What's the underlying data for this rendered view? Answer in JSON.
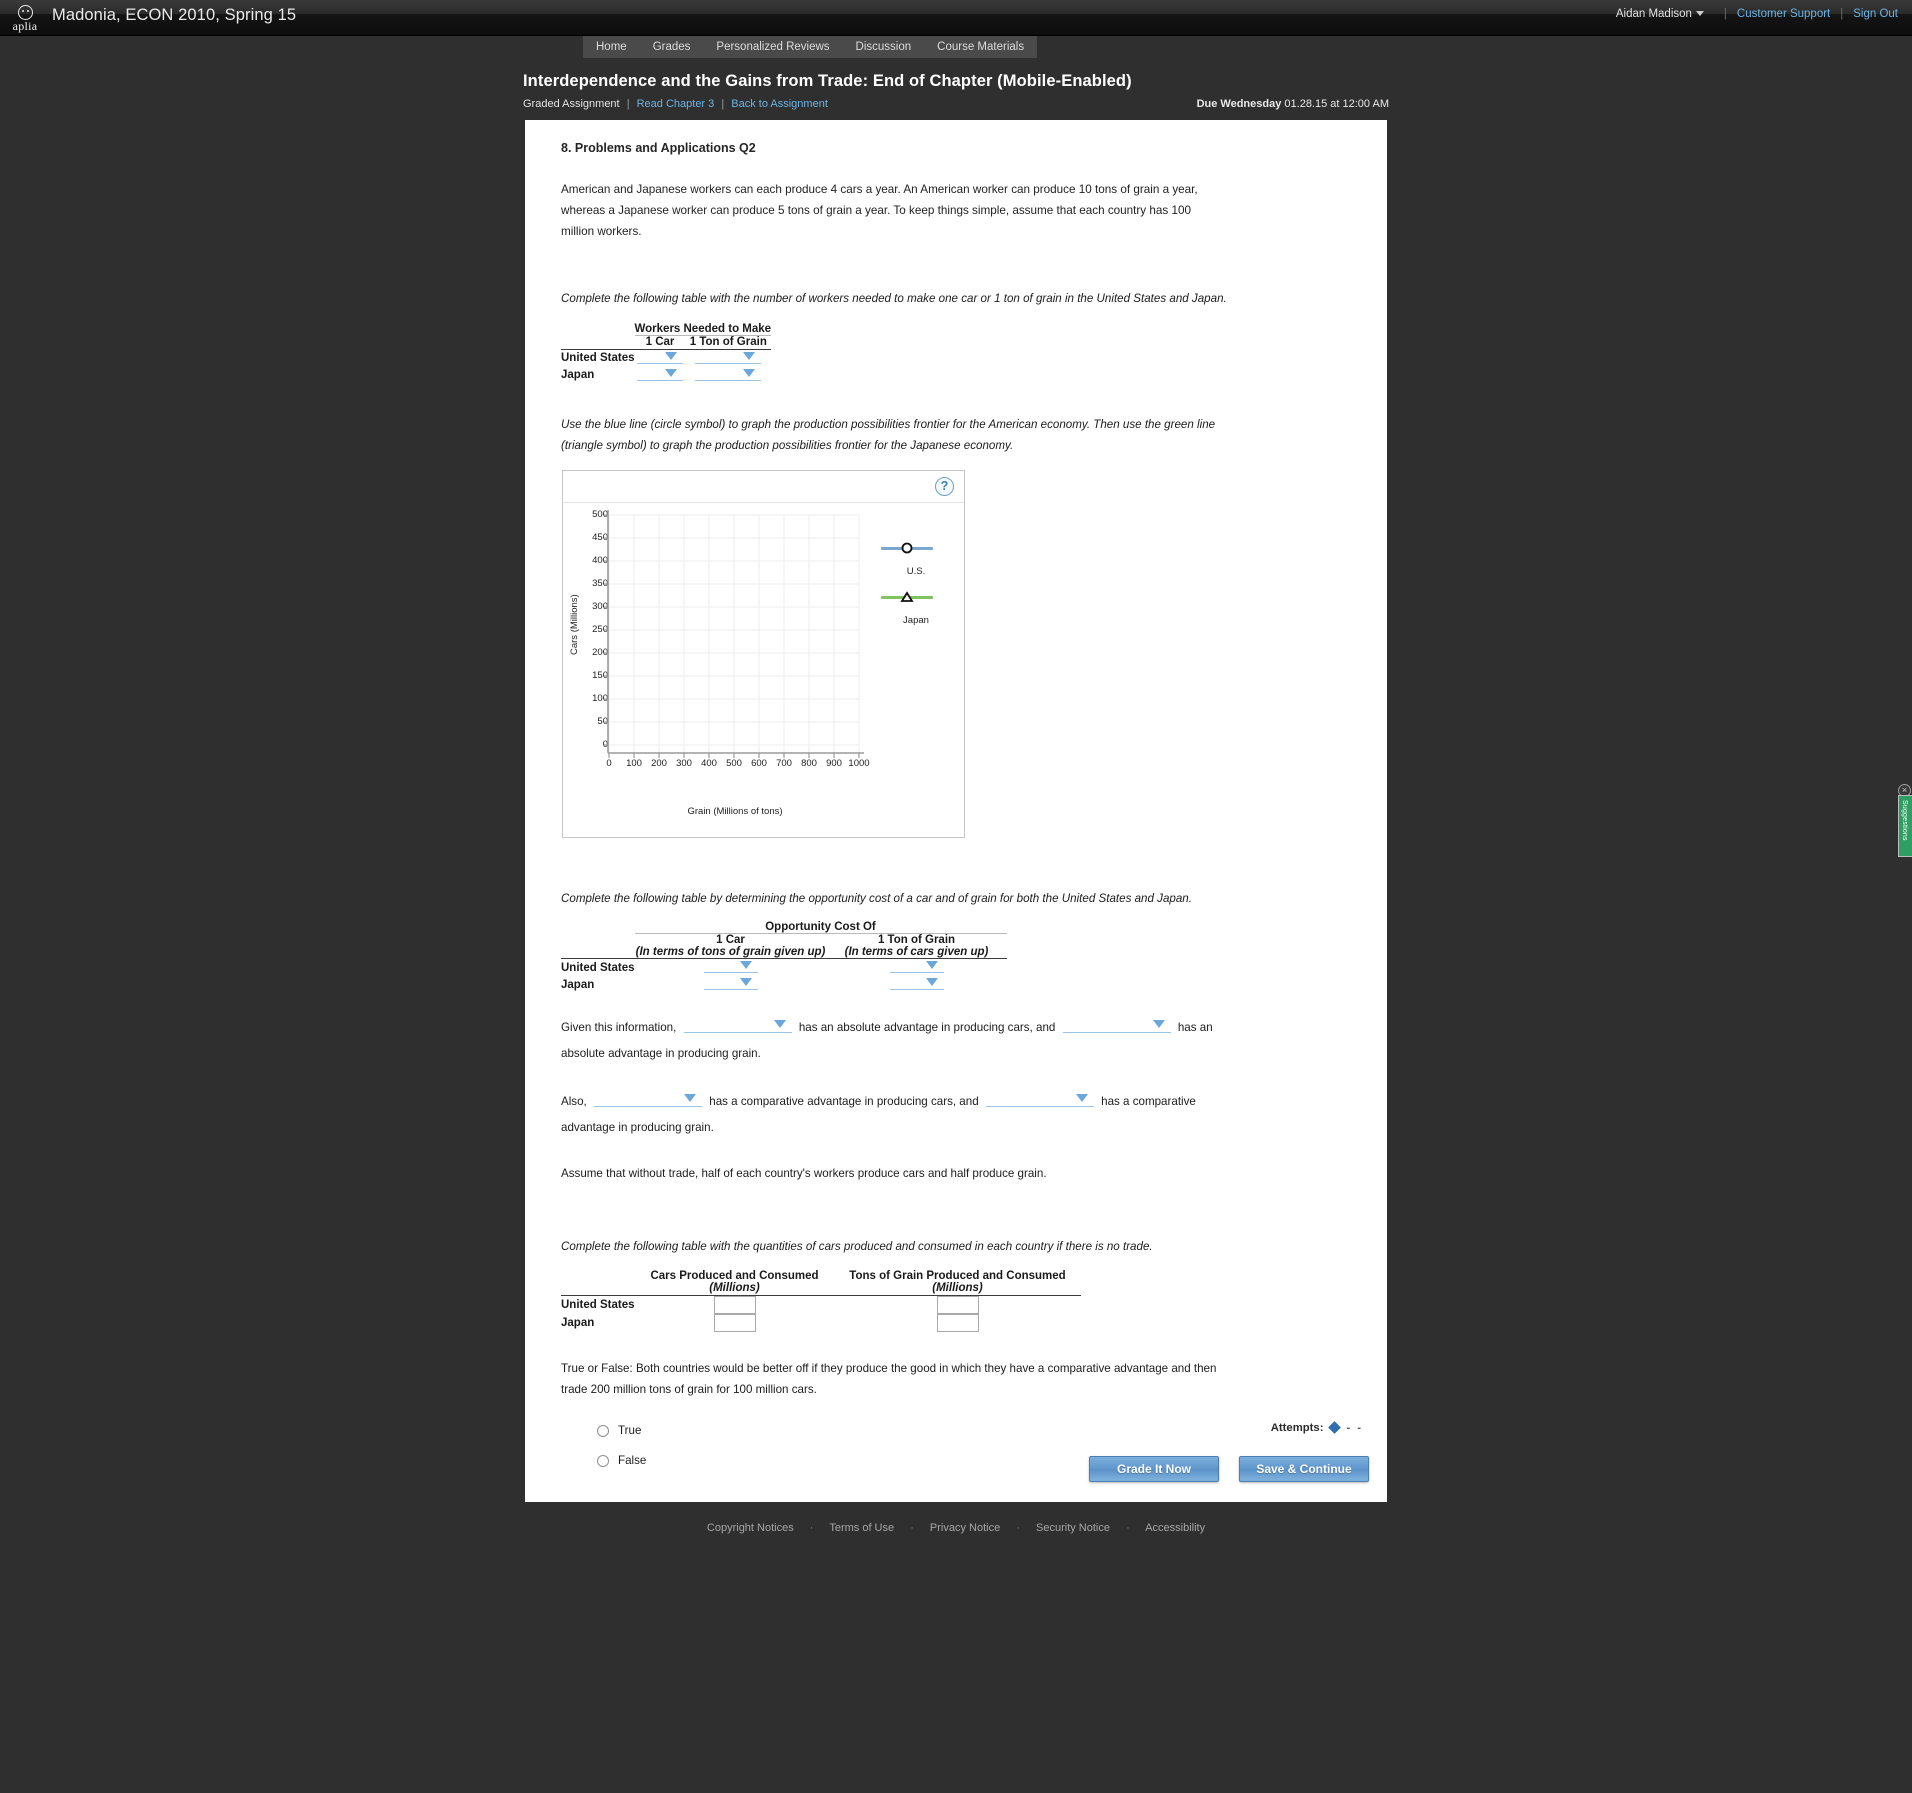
{
  "topbar": {
    "logo_text": "aplia",
    "course_title": "Madonia, ECON 2010, Spring 15",
    "user_name": "Aidan Madison",
    "customer_support": "Customer Support",
    "sign_out": "Sign Out"
  },
  "nav": {
    "items": [
      {
        "label": "Home"
      },
      {
        "label": "Grades"
      },
      {
        "label": "Personalized Reviews"
      },
      {
        "label": "Discussion"
      },
      {
        "label": "Course Materials"
      }
    ]
  },
  "assignment": {
    "title": "Interdependence and the Gains from Trade: End of Chapter (Mobile-Enabled)",
    "type_label": "Graded Assignment",
    "read_chapter_link": "Read Chapter 3",
    "back_link": "Back to Assignment",
    "due_prefix": "Due Wednesday",
    "due_value": "01.28.15 at 12:00 AM"
  },
  "question": {
    "heading": "8. Problems and Applications Q2",
    "body": "American and Japanese workers can each produce 4 cars a year. An American worker can produce 10 tons of grain a year, whereas a Japanese worker can produce 5 tons of grain a year. To keep things simple, assume that each country has 100 million workers."
  },
  "workers_table": {
    "prompt": "Complete the following table with the number of workers needed to make one car or 1 ton of grain in the United States and Japan.",
    "group_header": "Workers Needed to Make",
    "columns": [
      "1 Car",
      "1 Ton of Grain"
    ],
    "rows": [
      {
        "label": "United States",
        "car": "",
        "grain": ""
      },
      {
        "label": "Japan",
        "car": "",
        "grain": ""
      }
    ]
  },
  "graph": {
    "prompt": "Use the blue line (circle symbol) to graph the production possibilities frontier for the American economy. Then use the green line (triangle symbol) to graph the production possibilities frontier for the Japanese economy.",
    "help_label": "?",
    "legend": [
      {
        "label": "U.S.",
        "color": "#7ba7d0",
        "symbol": "circle"
      },
      {
        "label": "Japan",
        "color": "#7fc45c",
        "symbol": "triangle"
      }
    ]
  },
  "chart_data": {
    "type": "line",
    "title": "",
    "xlabel": "Grain (Millions of tons)",
    "ylabel": "Cars (Millions)",
    "xlim": [
      0,
      1000
    ],
    "ylim": [
      0,
      500
    ],
    "xticks": [
      0,
      100,
      200,
      300,
      400,
      500,
      600,
      700,
      800,
      900,
      1000
    ],
    "yticks": [
      0,
      50,
      100,
      150,
      200,
      250,
      300,
      350,
      400,
      450,
      500
    ],
    "grid": true,
    "legend_position": "right",
    "series": [
      {
        "name": "U.S.",
        "color": "#7ba7d0",
        "symbol": "circle",
        "x": [],
        "y": []
      },
      {
        "name": "Japan",
        "color": "#7fc45c",
        "symbol": "triangle",
        "x": [],
        "y": []
      }
    ]
  },
  "opp_cost_table": {
    "prompt": "Complete the following table by determining the opportunity cost of a car and of grain for both the United States and Japan.",
    "group_header": "Opportunity Cost Of",
    "columns": [
      {
        "title": "1 Car",
        "sub": "(In terms of tons of grain given up)"
      },
      {
        "title": "1 Ton of Grain",
        "sub": "(In terms of cars given up)"
      }
    ],
    "rows": [
      {
        "label": "United States",
        "car": "",
        "grain": ""
      },
      {
        "label": "Japan",
        "car": "",
        "grain": ""
      }
    ]
  },
  "absolute_sentence": {
    "lead": "Given this information,",
    "mid": "has an absolute advantage in producing cars, and",
    "tail": "has an absolute",
    "wrap": "advantage in producing grain."
  },
  "comparative_sentence": {
    "lead": "Also,",
    "mid": "has a comparative advantage in producing cars, and",
    "tail": "has a comparative advantage in",
    "wrap": "producing grain."
  },
  "assume_text": "Assume that without trade, half of each country's workers produce cars and half produce grain.",
  "no_trade_table": {
    "prompt": "Complete the following table with the quantities of cars produced and consumed in each country if there is no trade.",
    "columns": [
      {
        "title": "Cars Produced and Consumed",
        "sub": "(Millions)"
      },
      {
        "title": "Tons of Grain Produced and Consumed",
        "sub": "(Millions)"
      }
    ],
    "rows": [
      {
        "label": "United States",
        "cars": "",
        "grain": ""
      },
      {
        "label": "Japan",
        "cars": "",
        "grain": ""
      }
    ]
  },
  "true_false": {
    "question": "True or False: Both countries would be better off if they produce the good in which they have a comparative advantage and then trade 200 million tons of grain for 100 million cars.",
    "options": [
      {
        "label": "True",
        "selected": false
      },
      {
        "label": "False",
        "selected": false
      }
    ]
  },
  "actions": {
    "attempts_label": "Attempts:",
    "attempt_marks": [
      "-",
      "-"
    ],
    "grade_button": "Grade It Now",
    "save_button": "Save & Continue"
  },
  "footer": {
    "links": [
      "Copyright Notices",
      "Terms of Use",
      "Privacy Notice",
      "Security Notice",
      "Accessibility"
    ]
  },
  "edge_widget": {
    "label": "Suggestions"
  }
}
